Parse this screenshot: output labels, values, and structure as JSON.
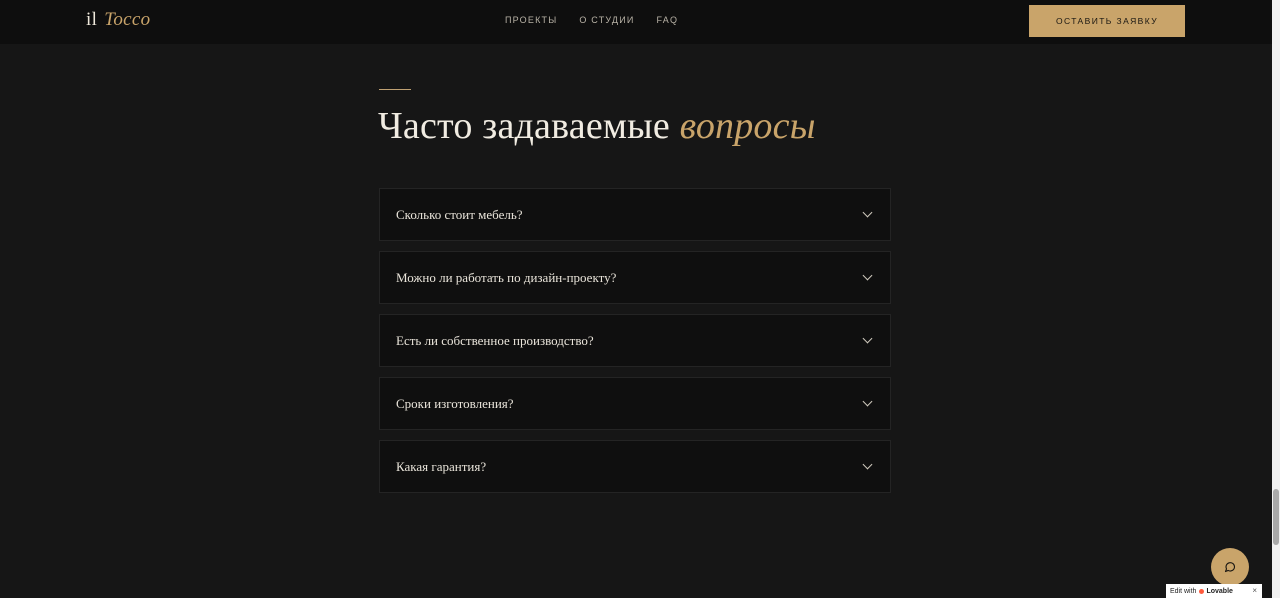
{
  "header": {
    "logo_main": "il",
    "logo_accent": "Tocco",
    "nav": [
      "ПРОЕКТЫ",
      "О СТУДИИ",
      "FAQ"
    ],
    "cta_label": "ОСТАВИТЬ ЗАЯВКУ"
  },
  "faq": {
    "title_main": "Часто задаваемые",
    "title_accent": "вопросы",
    "items": [
      {
        "question": "Сколько стоит мебель?"
      },
      {
        "question": "Можно ли работать по дизайн-проекту?"
      },
      {
        "question": "Есть ли собственное производство?"
      },
      {
        "question": "Сроки изготовления?"
      },
      {
        "question": "Какая гарантия?"
      }
    ]
  },
  "badge": {
    "prefix": "Edit with",
    "brand": "Lovable",
    "close": "×"
  },
  "colors": {
    "background": "#161616",
    "accent_gold": "#c9a46a",
    "text": "#e8e4dc"
  },
  "icons": [
    "chevron-down-icon",
    "chat-bubble-icon",
    "close-icon"
  ]
}
